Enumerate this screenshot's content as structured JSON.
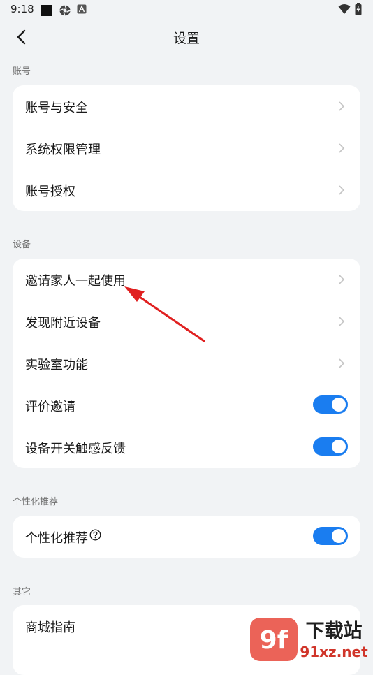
{
  "status_bar": {
    "time": "9:18",
    "icons": [
      "square-app-icon",
      "vpn-icon",
      "a-icon",
      "wifi-icon",
      "battery-charging-icon"
    ]
  },
  "header": {
    "title": "设置",
    "back_icon": "chevron-left-icon"
  },
  "sections": {
    "account": {
      "label": "账号",
      "items": [
        {
          "label": "账号与安全",
          "control": "chevron"
        },
        {
          "label": "系统权限管理",
          "control": "chevron"
        },
        {
          "label": "账号授权",
          "control": "chevron"
        }
      ]
    },
    "device": {
      "label": "设备",
      "items": [
        {
          "label": "邀请家人一起使用",
          "control": "chevron"
        },
        {
          "label": "发现附近设备",
          "control": "chevron"
        },
        {
          "label": "实验室功能",
          "control": "chevron"
        },
        {
          "label": "评价邀请",
          "control": "toggle",
          "on": true
        },
        {
          "label": "设备开关触感反馈",
          "control": "toggle",
          "on": true
        }
      ]
    },
    "personalization": {
      "label": "个性化推荐",
      "items": [
        {
          "label": "个性化推荐",
          "control": "toggle",
          "on": true,
          "help_icon": "question-circle-icon"
        }
      ]
    },
    "other": {
      "label": "其它",
      "items": [
        {
          "label": "商城指南",
          "control": "chevron"
        }
      ]
    }
  },
  "colors": {
    "background": "#f1f3f5",
    "card": "#ffffff",
    "toggle_on": "#1a7df0",
    "annotation_arrow": "#e02020"
  },
  "watermark": {
    "logo_text": "9f",
    "brand_text": "下载站",
    "url": "91xz.net"
  }
}
